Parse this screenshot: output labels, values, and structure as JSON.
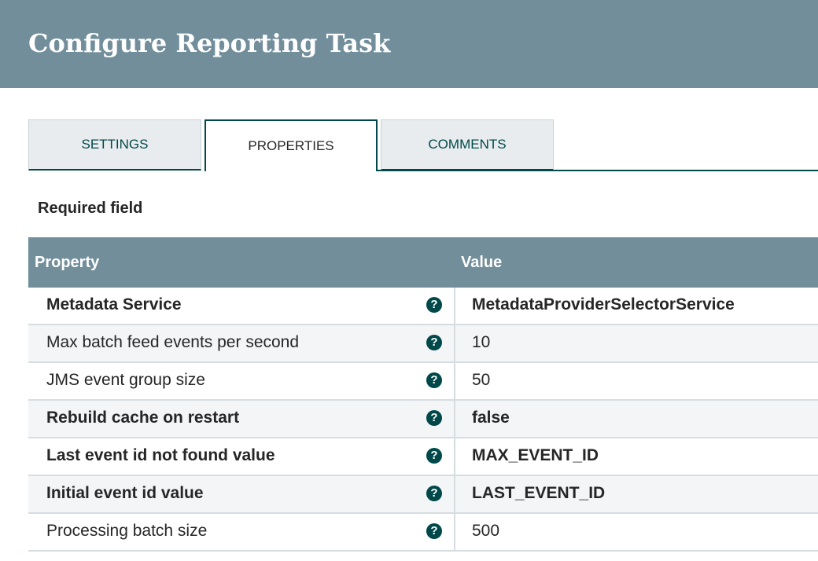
{
  "title": "Configure Reporting Task",
  "tabs": [
    {
      "label": "SETTINGS",
      "active": false
    },
    {
      "label": "PROPERTIES",
      "active": true
    },
    {
      "label": "COMMENTS",
      "active": false
    }
  ],
  "required_label": "Required field",
  "table": {
    "headers": {
      "property": "Property",
      "value": "Value"
    },
    "rows": [
      {
        "name": "Metadata Service",
        "value": "MetadataProviderSelectorService",
        "required": true
      },
      {
        "name": "Max batch feed events per second",
        "value": "10",
        "required": false
      },
      {
        "name": "JMS event group size",
        "value": "50",
        "required": false
      },
      {
        "name": "Rebuild cache on restart",
        "value": "false",
        "required": true
      },
      {
        "name": "Last event id not found value",
        "value": "MAX_EVENT_ID",
        "required": true
      },
      {
        "name": "Initial event id value",
        "value": "LAST_EVENT_ID",
        "required": true
      },
      {
        "name": "Processing batch size",
        "value": "500",
        "required": false
      }
    ]
  },
  "help_icon": "question-circle-icon",
  "colors": {
    "header": "#728e9b",
    "accent": "#004849"
  }
}
